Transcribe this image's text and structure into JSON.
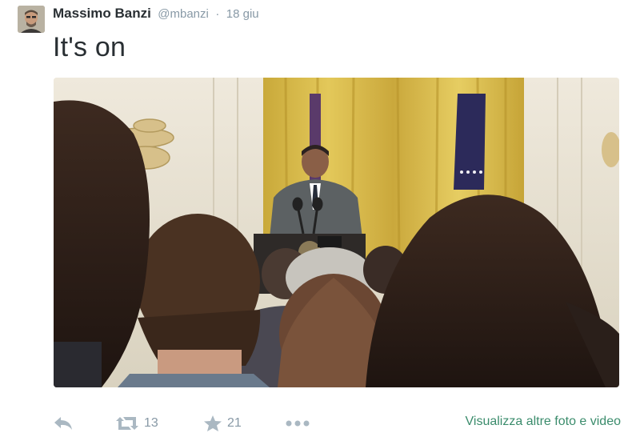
{
  "tweet": {
    "author_name": "Massimo Banzi",
    "author_handle": "@mbanzi",
    "separator": "·",
    "timestamp": "18 giu",
    "text": "It's on",
    "photo": {
      "subject": "speaker at podium, crowd in foreground, gold curtain backdrop"
    }
  },
  "actions": {
    "reply_icon": "reply-icon",
    "retweet_icon": "retweet-icon",
    "retweet_count": "13",
    "favorite_icon": "star-icon",
    "favorite_count": "21",
    "more_icon": "ellipsis-icon",
    "view_more_label": "Visualizza altre foto e video"
  },
  "colors": {
    "text": "#292f33",
    "muted": "#8899a6",
    "icon": "#aab8c2",
    "link": "#3b8c6c"
  }
}
